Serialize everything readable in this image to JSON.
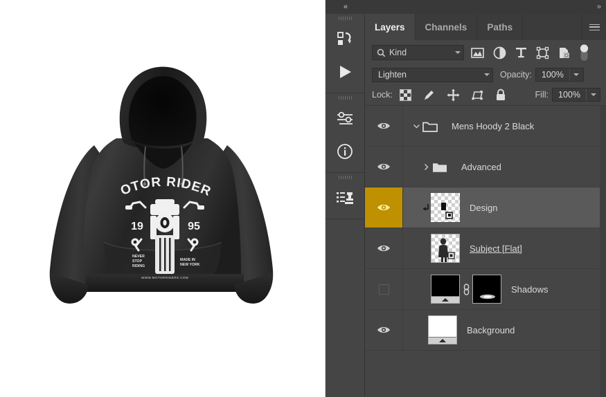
{
  "window": {
    "collapse_left_label": "«",
    "collapse_right_label": "»"
  },
  "canvas": {
    "artwork_name": "Mens Hoody 2 Black mockup",
    "design_print": {
      "headline": "MOTOR RIDERS",
      "year_left": "19",
      "year_right": "95",
      "tagline_left": "NEVER STOP RIDING",
      "tagline_right": "MADE IN NEW YORK",
      "url": "WWW.MOTORRIDERS.COM"
    }
  },
  "rail": {
    "groups": [
      {
        "items": [
          {
            "name": "history-icon",
            "label": "History"
          },
          {
            "name": "play-icon",
            "label": "Actions"
          }
        ]
      },
      {
        "items": [
          {
            "name": "adjustments-icon",
            "label": "Adjustments"
          },
          {
            "name": "info-icon",
            "label": "Info"
          }
        ]
      },
      {
        "items": [
          {
            "name": "clone-source-icon",
            "label": "Clone Source"
          }
        ]
      }
    ]
  },
  "panel": {
    "tabs": [
      {
        "label": "Layers",
        "active": true
      },
      {
        "label": "Channels",
        "active": false
      },
      {
        "label": "Paths",
        "active": false
      }
    ],
    "menu_label": "Panel menu",
    "filter": {
      "search_icon": "search-icon",
      "kind_value": "Kind",
      "icons": [
        {
          "name": "filter-pixel-icon",
          "label": "Pixel layers"
        },
        {
          "name": "filter-adjustment-icon",
          "label": "Adjustment layers"
        },
        {
          "name": "filter-type-icon",
          "label": "Type layers"
        },
        {
          "name": "filter-shape-icon",
          "label": "Shape layers"
        },
        {
          "name": "filter-smart-object-icon",
          "label": "Smart objects"
        },
        {
          "name": "filter-toggle-switch",
          "label": "Filter on/off"
        }
      ]
    },
    "blend": {
      "mode_value": "Lighten",
      "opacity_label": "Opacity:",
      "opacity_value": "100%"
    },
    "lock": {
      "label": "Lock:",
      "icons": [
        {
          "name": "lock-transparent-pixels-icon",
          "label": "Lock transparent pixels"
        },
        {
          "name": "lock-image-pixels-icon",
          "label": "Lock image pixels"
        },
        {
          "name": "lock-position-icon",
          "label": "Lock position"
        },
        {
          "name": "lock-artboard-nesting-icon",
          "label": "Prevent auto-nesting"
        },
        {
          "name": "lock-all-icon",
          "label": "Lock all"
        }
      ],
      "fill_label": "Fill:",
      "fill_value": "100%"
    },
    "layers": [
      {
        "name": "Mens Hoody 2 Black",
        "type": "group",
        "visible": true,
        "expanded": true,
        "indent": 0,
        "selected": false,
        "underlined": false,
        "disclosure": "chevron-down-icon"
      },
      {
        "name": "Advanced",
        "type": "group",
        "visible": true,
        "expanded": false,
        "indent": 1,
        "selected": false,
        "underlined": false,
        "disclosure": "chevron-right-icon"
      },
      {
        "name": "Design",
        "type": "layer",
        "visible": true,
        "clipped": true,
        "indent": 1,
        "selected": true,
        "eye_highlight": true,
        "underlined": false,
        "thumb": "transparent-design"
      },
      {
        "name": "Subject [Flat]",
        "type": "layer",
        "visible": true,
        "clipped": false,
        "indent": 1,
        "selected": false,
        "underlined": true,
        "thumb": "transparent-subject"
      },
      {
        "name": "Shadows",
        "type": "layer",
        "visible": false,
        "clipped": false,
        "indent": 1,
        "selected": false,
        "underlined": false,
        "thumb": "black-fill",
        "mask": "shadow-mask",
        "linked": true
      },
      {
        "name": "Background",
        "type": "layer",
        "visible": true,
        "clipped": false,
        "indent": 0,
        "selected": false,
        "underlined": false,
        "thumb": "white-fill"
      }
    ]
  },
  "colors": {
    "panel_bg": "#454545",
    "tab_strip_bg": "#3b3b3b",
    "selected_row": "#5a5a5a",
    "eye_highlight": "#bf9000",
    "text_primary": "#dadada",
    "text_muted": "#a9a9a9",
    "field_bg": "#3a3a3a"
  }
}
